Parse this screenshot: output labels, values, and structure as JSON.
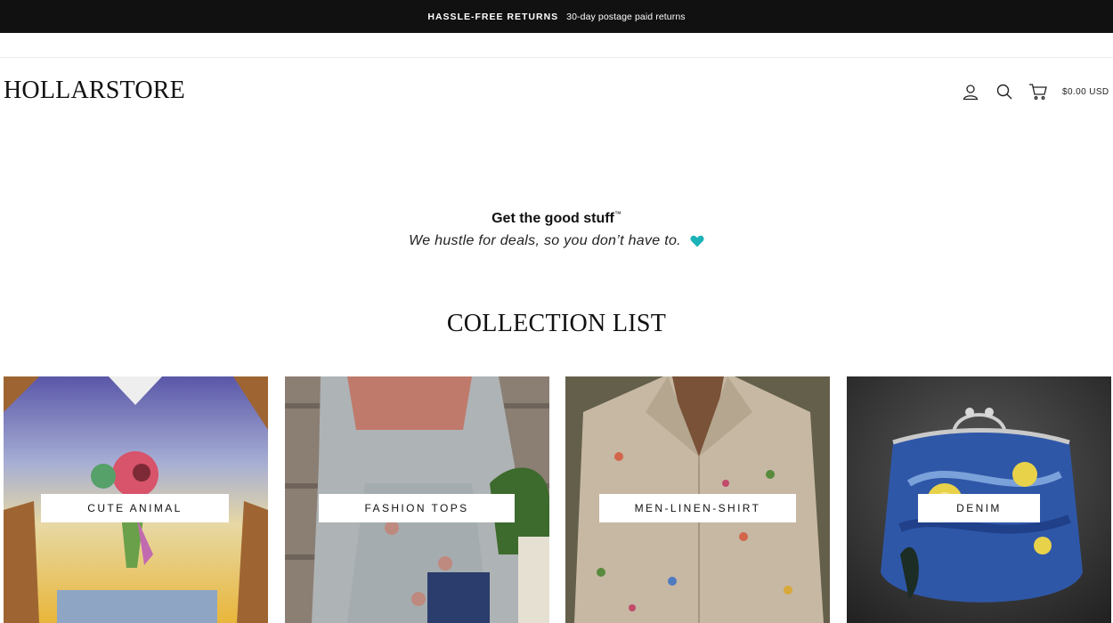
{
  "announcement": {
    "strong": "HASSLE-FREE RETURNS",
    "text": "30-day postage paid returns"
  },
  "header": {
    "logo": "HOLLARSTORE",
    "icons": [
      "account-icon",
      "search-icon",
      "cart-icon"
    ],
    "cart_total": "$0.00 USD"
  },
  "promo": {
    "title": "Get the good stuff",
    "trademark": "™",
    "subtitle": "We hustle for deals, so you don’t have to.",
    "heart_color": "#1bb3b8"
  },
  "collections": {
    "title": "COLLECTION LIST",
    "items": [
      {
        "label": "CUTE ANIMAL"
      },
      {
        "label": "FASHION TOPS"
      },
      {
        "label": "MEN-LINEN-SHIRT"
      },
      {
        "label": "DENIM"
      }
    ]
  }
}
